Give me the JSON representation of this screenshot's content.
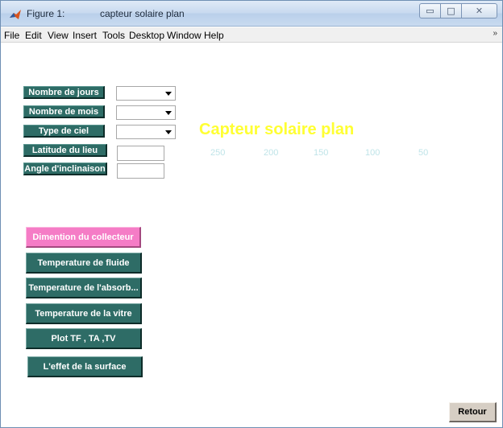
{
  "window": {
    "figure_label": "Figure 1:",
    "title": "capteur solaire plan",
    "controls": {
      "minimize": "▭",
      "maximize": "□",
      "close": "✕"
    }
  },
  "menu": [
    "File",
    "Edit",
    "View",
    "Insert",
    "Tools",
    "Desktop",
    "Window",
    "Help"
  ],
  "menu_overflow_icon": "»",
  "form": {
    "labels": {
      "jours": "Nombre de jours",
      "mois": "Nombre de mois",
      "ciel": "Type de ciel",
      "latitude": "Latitude du lieu",
      "angle": "Angle d'inclinaison"
    },
    "values": {
      "jours": "",
      "mois": "",
      "ciel": "",
      "latitude": "",
      "angle": ""
    }
  },
  "heading": "Capteur solaire plan",
  "ticks": [
    "250",
    "200",
    "150",
    "100",
    "50"
  ],
  "buttons": {
    "dimention": "Dimention du collecteur",
    "fluide": "Temperature de fluide",
    "absorb": "Temperature de l'absorb...",
    "vitre": "Temperature de la vitre",
    "plot": "Plot TF , TA ,TV",
    "effet": "L'effet de la surface",
    "retour": "Retour"
  },
  "colors": {
    "teal": "#2e6c66",
    "pink": "#f57cc6",
    "heading": "#ffff33",
    "tick": "#bfe4e8"
  }
}
